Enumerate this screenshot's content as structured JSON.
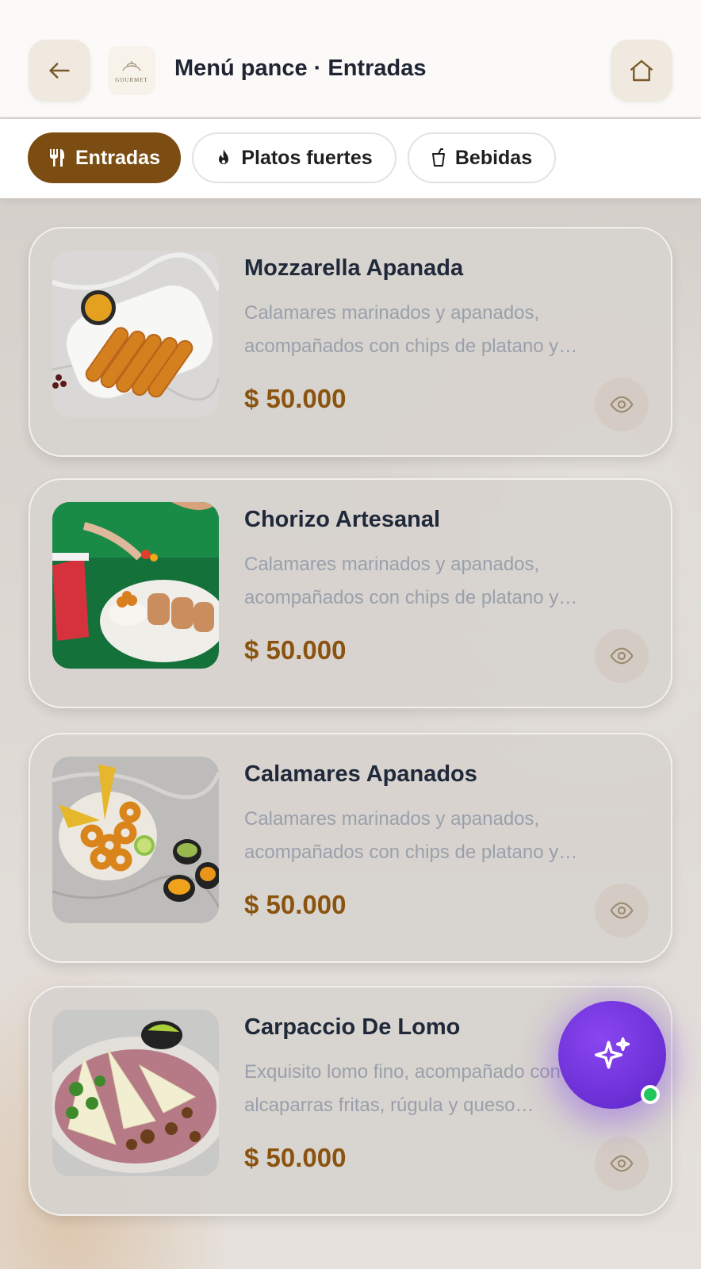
{
  "header": {
    "title": "Menú pance · Entradas",
    "logo_text": "GOURMET",
    "back_icon": "arrow-left-icon",
    "home_icon": "home-icon"
  },
  "tabs": [
    {
      "label": "Entradas",
      "icon": "utensils-icon",
      "active": true
    },
    {
      "label": "Platos fuertes",
      "icon": "flame-icon",
      "active": false
    },
    {
      "label": "Bebidas",
      "icon": "cup-icon",
      "active": false
    }
  ],
  "items": [
    {
      "name": "Mozzarella Apanada",
      "description": "Calamares marinados y apanados, acompañados con chips de platano y…",
      "price": "$ 50.000"
    },
    {
      "name": "Chorizo Artesanal",
      "description": "Calamares marinados y apanados, acompañados con chips de platano y…",
      "price": "$ 50.000"
    },
    {
      "name": "Calamares Apanados",
      "description": "Calamares marinados y apanados, acompañados con chips de platano y…",
      "price": "$ 50.000"
    },
    {
      "name": "Carpaccio De Lomo",
      "description": "Exquisito lomo fino, acompañado con alcaparras fritas, rúgula y queso…",
      "price": "$ 50.000"
    }
  ],
  "colors": {
    "accent": "#7c4d12",
    "price": "#8a5410",
    "fab": "#6a2fd4",
    "online_dot": "#22c55e"
  }
}
